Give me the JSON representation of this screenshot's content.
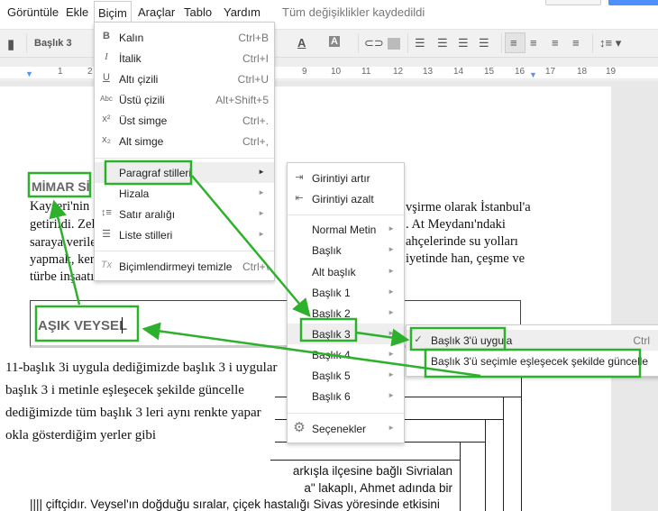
{
  "menubar": {
    "items": [
      "Görüntüle",
      "Ekle",
      "Biçim",
      "Araçlar",
      "Tablo",
      "Yardım"
    ],
    "status": "Tüm değişiklikler kaydedildi"
  },
  "toolbar": {
    "style": "Başlık 3"
  },
  "ruler": {
    "numbers": [
      "1",
      "2",
      "9",
      "10",
      "11",
      "12",
      "13",
      "14",
      "15",
      "16",
      "17",
      "18",
      "19"
    ]
  },
  "format_menu": {
    "items": [
      {
        "icon": "bold-icon",
        "glyph": "B",
        "label": "Kalın",
        "shortcut": "Ctrl+B"
      },
      {
        "icon": "italic-icon",
        "glyph": "I",
        "label": "İtalik",
        "shortcut": "Ctrl+I"
      },
      {
        "icon": "underline-icon",
        "glyph": "U",
        "label": "Altı çizili",
        "shortcut": "Ctrl+U"
      },
      {
        "icon": "strikethrough-icon",
        "glyph": "Abc",
        "label": "Üstü çizili",
        "shortcut": "Alt+Shift+5"
      },
      {
        "icon": "superscript-icon",
        "glyph": "x²",
        "label": "Üst simge",
        "shortcut": "Ctrl+."
      },
      {
        "icon": "subscript-icon",
        "glyph": "x₂",
        "label": "Alt simge",
        "shortcut": "Ctrl+,"
      },
      {
        "icon": "",
        "glyph": "",
        "label": "Paragraf stilleri",
        "submenu": true
      },
      {
        "icon": "",
        "glyph": "",
        "label": "Hizala",
        "submenu": true
      },
      {
        "icon": "line-spacing-icon",
        "glyph": "↕≡",
        "label": "Satır aralığı",
        "submenu": true
      },
      {
        "icon": "list-icon",
        "glyph": "☰",
        "label": "Liste stilleri",
        "submenu": true
      },
      {
        "icon": "clear-formatting-icon",
        "glyph": "Tx",
        "label": "Biçimlendirmeyi temizle",
        "shortcut": "Ctrl+\\"
      }
    ]
  },
  "paragraph_styles_menu": {
    "items": [
      {
        "icon": "indent-increase-icon",
        "label": "Girintiyi artır"
      },
      {
        "icon": "indent-decrease-icon",
        "label": "Girintiyi azalt"
      },
      {
        "label": "Normal Metin"
      },
      {
        "label": "Başlık"
      },
      {
        "label": "Alt başlık"
      },
      {
        "label": "Başlık 1"
      },
      {
        "label": "Başlık 2"
      },
      {
        "label": "Başlık 3"
      },
      {
        "label": "Başlık 4"
      },
      {
        "label": "Başlık 5"
      },
      {
        "label": "Başlık 6"
      },
      {
        "icon": "gear-icon",
        "label": "Seçenekler"
      }
    ]
  },
  "heading3_menu": {
    "apply": "Başlık 3'ü uygula",
    "apply_shortcut": "Ctrl",
    "update": "Başlık 3'ü seçimle eşleşecek şekilde güncelle"
  },
  "document": {
    "heading1": "MİMAR Sİ",
    "left_lines": [
      "Kayseri'nin",
      "getirildi. Zel",
      "saraya verile",
      "yapmak, ker",
      "türbe inşaatı"
    ],
    "right_lines": [
      "vşirme olarak İstanbul'a",
      ". At Meydanı'ndaki",
      "ahçelerinde su yolları",
      "iyetinde han, çeşme ve"
    ],
    "heading2": "AŞIK VEYSEL",
    "bottom_lines": [
      "arkışla ilçesine bağlı Sivrialan",
      "a\" lakaplı, Ahmet adında bir",
      "çiftçidır. Veysel'ın doğduğu sıralar, çiçek hastalığı Sivas yöresinde etkisini"
    ]
  },
  "annotation": {
    "lines": [
      "11-başlık 3i uygula dediğimizde başlık 3 i uygular",
      "başlık 3 i metinle  eşleşecek şekilde güncelle",
      "dediğimizde tüm başlık 3 leri aynı renkte yapar",
      "okla gösterdiğim yerler gibi"
    ]
  },
  "colors": {
    "highlight": "#22aa22",
    "menu_hover": "#eeeeee",
    "heading_gray": "#666666"
  }
}
